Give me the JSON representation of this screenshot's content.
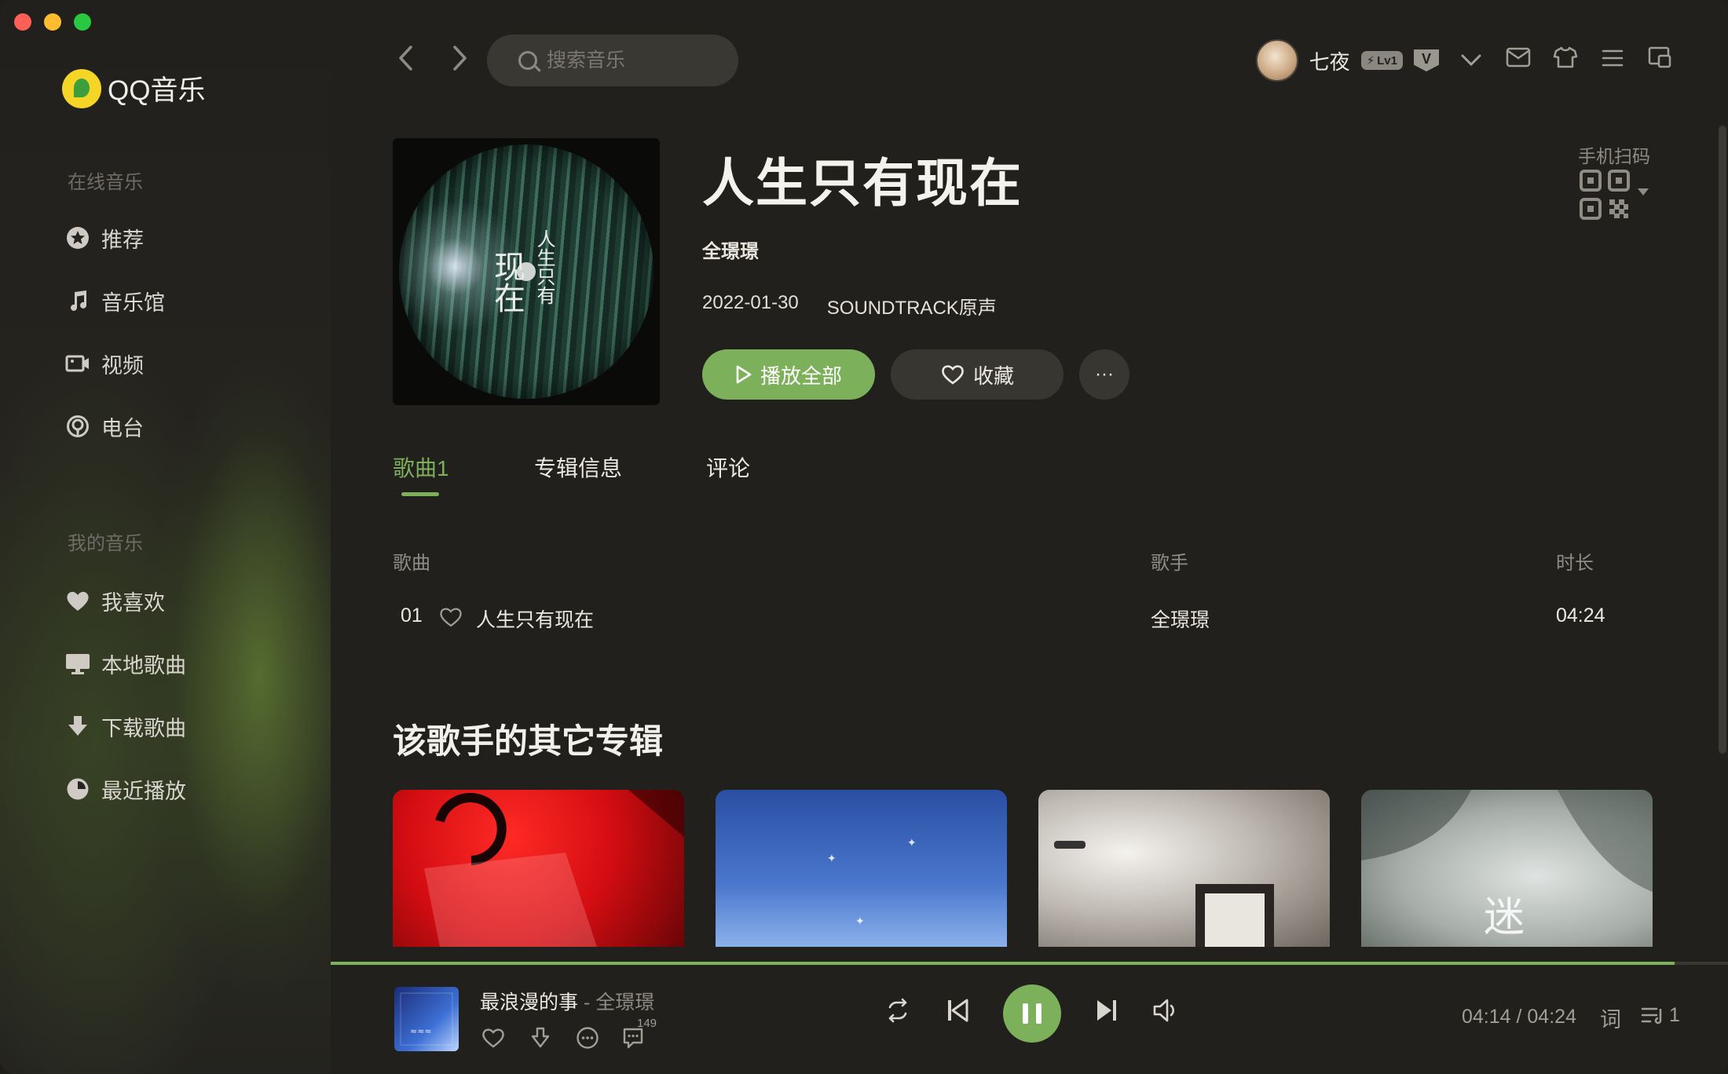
{
  "app": {
    "name": "QQ音乐"
  },
  "sidebar": {
    "online_label": "在线音乐",
    "online_items": [
      {
        "label": "推荐",
        "icon": "star-badge-icon"
      },
      {
        "label": "音乐馆",
        "icon": "music-note-icon"
      },
      {
        "label": "视频",
        "icon": "video-camera-icon"
      },
      {
        "label": "电台",
        "icon": "radio-icon"
      }
    ],
    "mine_label": "我的音乐",
    "mine_items": [
      {
        "label": "我喜欢",
        "icon": "heart-icon"
      },
      {
        "label": "本地歌曲",
        "icon": "monitor-icon"
      },
      {
        "label": "下载歌曲",
        "icon": "download-arrow-icon"
      },
      {
        "label": "最近播放",
        "icon": "clock-icon"
      }
    ]
  },
  "header": {
    "search_placeholder": "搜索音乐",
    "username": "七夜",
    "level_badge": "Lv1",
    "vip_badge": "V"
  },
  "album": {
    "cover_text_main": "现在",
    "cover_text_side": "人生只有",
    "title": "人生只有现在",
    "artist": "全璟璟",
    "date": "2022-01-30",
    "genre": "SOUNDTRACK原声",
    "play_all_label": "播放全部",
    "favorite_label": "收藏",
    "more_label": "···",
    "qr_label": "手机扫码"
  },
  "tabs": [
    {
      "label": "歌曲1",
      "active": true
    },
    {
      "label": "专辑信息",
      "active": false
    },
    {
      "label": "评论",
      "active": false
    }
  ],
  "track_table": {
    "headers": {
      "song": "歌曲",
      "artist": "歌手",
      "duration": "时长"
    },
    "rows": [
      {
        "index": "01",
        "title": "人生只有现在",
        "artist": "全璟璟",
        "duration": "04:24"
      }
    ]
  },
  "other_albums": {
    "title": "该歌手的其它专辑",
    "card_text_4": "迷"
  },
  "player": {
    "song": "最浪漫的事",
    "separator": "-",
    "artist": "全璟璟",
    "comment_count": "149",
    "current_time": "04:14",
    "total_time": "04:24",
    "time_separator": " / ",
    "lyric_label": "词",
    "queue_count": "1",
    "progress_fraction": 0.962
  },
  "colors": {
    "accent": "#7db05a",
    "background": "#22201d",
    "button_dark": "#383631"
  }
}
